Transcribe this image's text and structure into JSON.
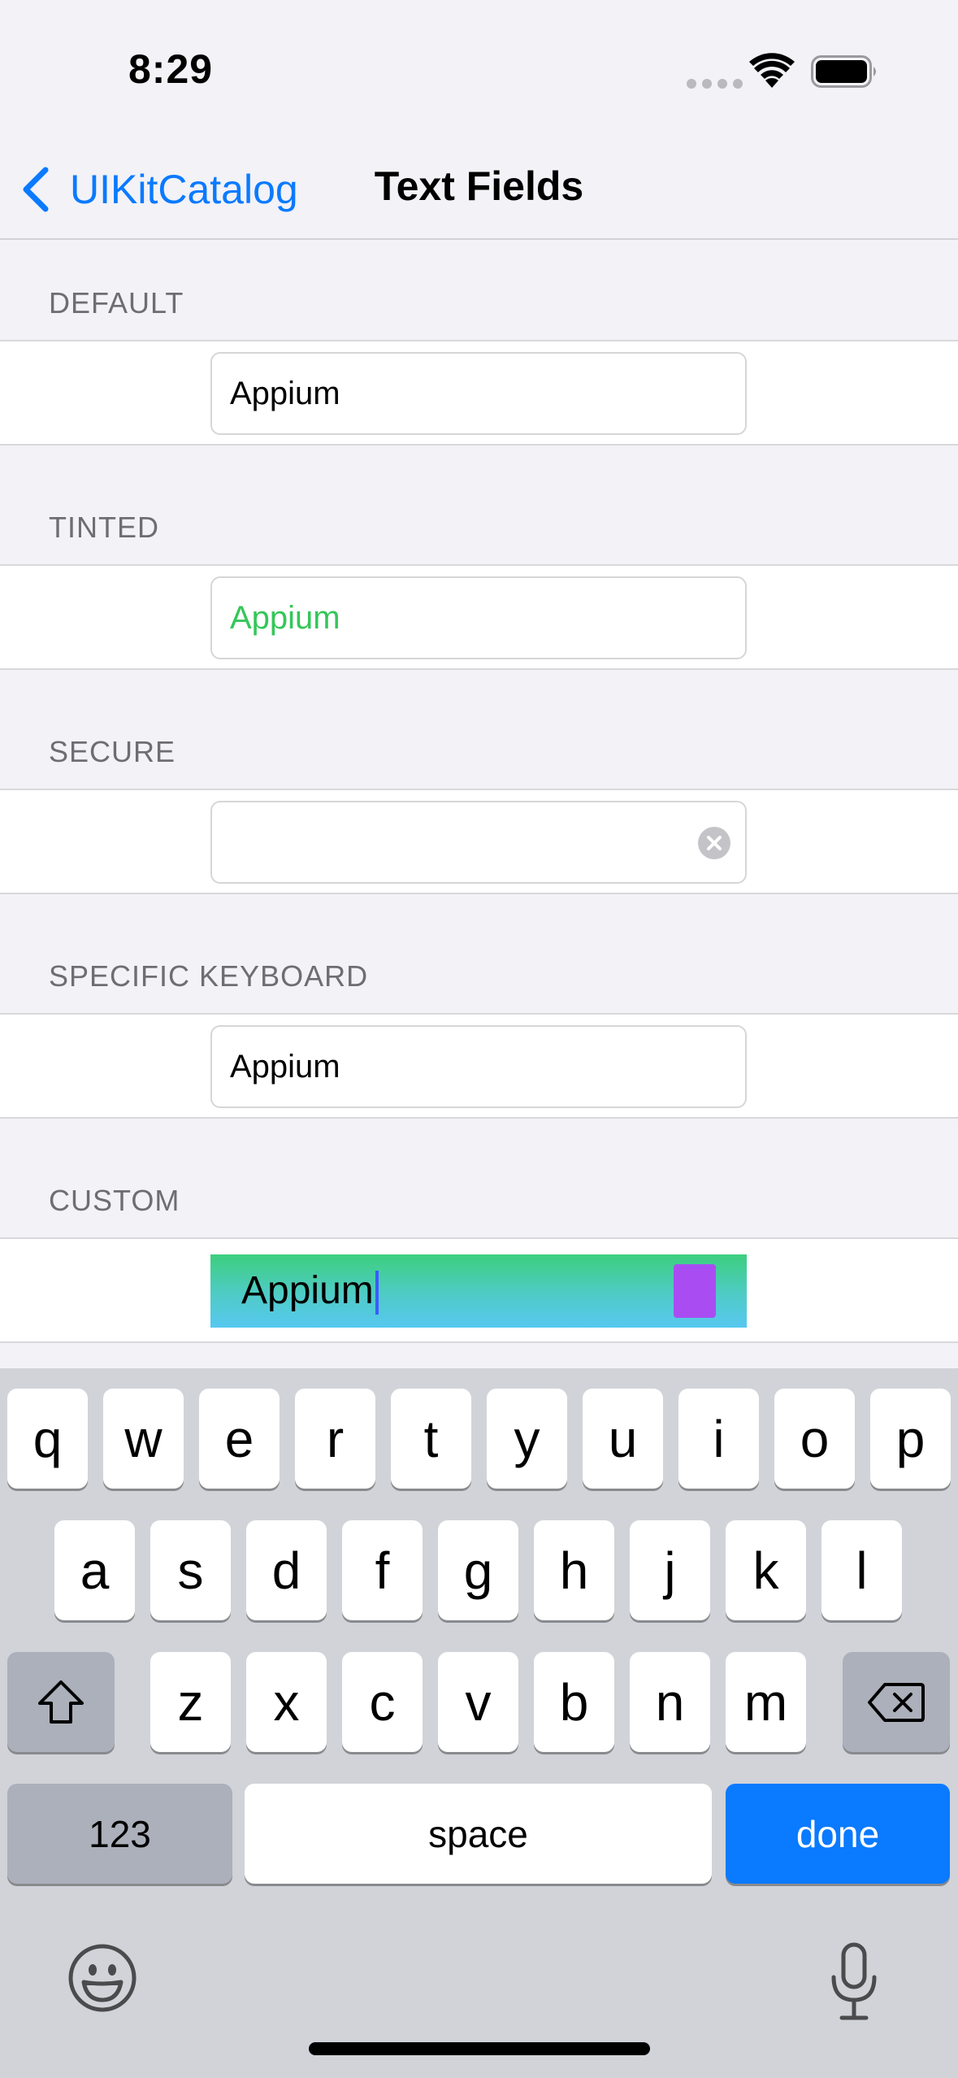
{
  "status_bar": {
    "time": "8:29"
  },
  "nav": {
    "back_label": "UIKitCatalog",
    "title": "Text Fields"
  },
  "sections": [
    {
      "header": "DEFAULT",
      "value": "Appium",
      "text_color": "#000000"
    },
    {
      "header": "TINTED",
      "value": "Appium",
      "text_color": "#34C759"
    },
    {
      "header": "SECURE",
      "value": ""
    },
    {
      "header": "SPECIFIC KEYBOARD",
      "value": "Appium"
    },
    {
      "header": "CUSTOM",
      "value": "Appium",
      "gradient": [
        "#3CCF7E",
        "#57C8F0"
      ],
      "button_color": "#A94DF2"
    }
  ],
  "keyboard": {
    "row1": [
      "q",
      "w",
      "e",
      "r",
      "t",
      "y",
      "u",
      "i",
      "o",
      "p"
    ],
    "row2": [
      "a",
      "s",
      "d",
      "f",
      "g",
      "h",
      "j",
      "k",
      "l"
    ],
    "row3": [
      "z",
      "x",
      "c",
      "v",
      "b",
      "n",
      "m"
    ],
    "numbers_label": "123",
    "space_label": "space",
    "done_label": "done"
  },
  "colors": {
    "accent": "#0A7AFF",
    "tint": "#34C759",
    "background": "#F2F2F7"
  }
}
